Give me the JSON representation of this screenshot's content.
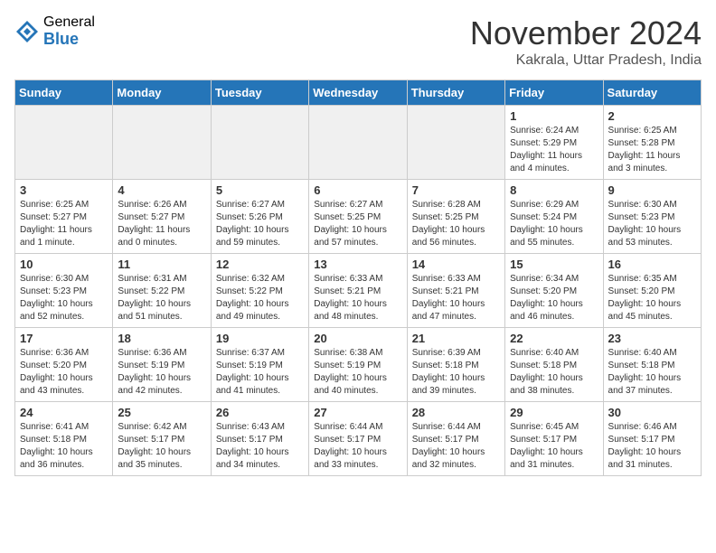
{
  "logo": {
    "general": "General",
    "blue": "Blue"
  },
  "header": {
    "month": "November 2024",
    "location": "Kakrala, Uttar Pradesh, India"
  },
  "weekdays": [
    "Sunday",
    "Monday",
    "Tuesday",
    "Wednesday",
    "Thursday",
    "Friday",
    "Saturday"
  ],
  "weeks": [
    [
      {
        "day": "",
        "sunrise": "",
        "sunset": "",
        "daylight": "",
        "empty": true
      },
      {
        "day": "",
        "sunrise": "",
        "sunset": "",
        "daylight": "",
        "empty": true
      },
      {
        "day": "",
        "sunrise": "",
        "sunset": "",
        "daylight": "",
        "empty": true
      },
      {
        "day": "",
        "sunrise": "",
        "sunset": "",
        "daylight": "",
        "empty": true
      },
      {
        "day": "",
        "sunrise": "",
        "sunset": "",
        "daylight": "",
        "empty": true
      },
      {
        "day": "1",
        "sunrise": "Sunrise: 6:24 AM",
        "sunset": "Sunset: 5:29 PM",
        "daylight": "Daylight: 11 hours and 4 minutes.",
        "empty": false
      },
      {
        "day": "2",
        "sunrise": "Sunrise: 6:25 AM",
        "sunset": "Sunset: 5:28 PM",
        "daylight": "Daylight: 11 hours and 3 minutes.",
        "empty": false
      }
    ],
    [
      {
        "day": "3",
        "sunrise": "Sunrise: 6:25 AM",
        "sunset": "Sunset: 5:27 PM",
        "daylight": "Daylight: 11 hours and 1 minute.",
        "empty": false
      },
      {
        "day": "4",
        "sunrise": "Sunrise: 6:26 AM",
        "sunset": "Sunset: 5:27 PM",
        "daylight": "Daylight: 11 hours and 0 minutes.",
        "empty": false
      },
      {
        "day": "5",
        "sunrise": "Sunrise: 6:27 AM",
        "sunset": "Sunset: 5:26 PM",
        "daylight": "Daylight: 10 hours and 59 minutes.",
        "empty": false
      },
      {
        "day": "6",
        "sunrise": "Sunrise: 6:27 AM",
        "sunset": "Sunset: 5:25 PM",
        "daylight": "Daylight: 10 hours and 57 minutes.",
        "empty": false
      },
      {
        "day": "7",
        "sunrise": "Sunrise: 6:28 AM",
        "sunset": "Sunset: 5:25 PM",
        "daylight": "Daylight: 10 hours and 56 minutes.",
        "empty": false
      },
      {
        "day": "8",
        "sunrise": "Sunrise: 6:29 AM",
        "sunset": "Sunset: 5:24 PM",
        "daylight": "Daylight: 10 hours and 55 minutes.",
        "empty": false
      },
      {
        "day": "9",
        "sunrise": "Sunrise: 6:30 AM",
        "sunset": "Sunset: 5:23 PM",
        "daylight": "Daylight: 10 hours and 53 minutes.",
        "empty": false
      }
    ],
    [
      {
        "day": "10",
        "sunrise": "Sunrise: 6:30 AM",
        "sunset": "Sunset: 5:23 PM",
        "daylight": "Daylight: 10 hours and 52 minutes.",
        "empty": false
      },
      {
        "day": "11",
        "sunrise": "Sunrise: 6:31 AM",
        "sunset": "Sunset: 5:22 PM",
        "daylight": "Daylight: 10 hours and 51 minutes.",
        "empty": false
      },
      {
        "day": "12",
        "sunrise": "Sunrise: 6:32 AM",
        "sunset": "Sunset: 5:22 PM",
        "daylight": "Daylight: 10 hours and 49 minutes.",
        "empty": false
      },
      {
        "day": "13",
        "sunrise": "Sunrise: 6:33 AM",
        "sunset": "Sunset: 5:21 PM",
        "daylight": "Daylight: 10 hours and 48 minutes.",
        "empty": false
      },
      {
        "day": "14",
        "sunrise": "Sunrise: 6:33 AM",
        "sunset": "Sunset: 5:21 PM",
        "daylight": "Daylight: 10 hours and 47 minutes.",
        "empty": false
      },
      {
        "day": "15",
        "sunrise": "Sunrise: 6:34 AM",
        "sunset": "Sunset: 5:20 PM",
        "daylight": "Daylight: 10 hours and 46 minutes.",
        "empty": false
      },
      {
        "day": "16",
        "sunrise": "Sunrise: 6:35 AM",
        "sunset": "Sunset: 5:20 PM",
        "daylight": "Daylight: 10 hours and 45 minutes.",
        "empty": false
      }
    ],
    [
      {
        "day": "17",
        "sunrise": "Sunrise: 6:36 AM",
        "sunset": "Sunset: 5:20 PM",
        "daylight": "Daylight: 10 hours and 43 minutes.",
        "empty": false
      },
      {
        "day": "18",
        "sunrise": "Sunrise: 6:36 AM",
        "sunset": "Sunset: 5:19 PM",
        "daylight": "Daylight: 10 hours and 42 minutes.",
        "empty": false
      },
      {
        "day": "19",
        "sunrise": "Sunrise: 6:37 AM",
        "sunset": "Sunset: 5:19 PM",
        "daylight": "Daylight: 10 hours and 41 minutes.",
        "empty": false
      },
      {
        "day": "20",
        "sunrise": "Sunrise: 6:38 AM",
        "sunset": "Sunset: 5:19 PM",
        "daylight": "Daylight: 10 hours and 40 minutes.",
        "empty": false
      },
      {
        "day": "21",
        "sunrise": "Sunrise: 6:39 AM",
        "sunset": "Sunset: 5:18 PM",
        "daylight": "Daylight: 10 hours and 39 minutes.",
        "empty": false
      },
      {
        "day": "22",
        "sunrise": "Sunrise: 6:40 AM",
        "sunset": "Sunset: 5:18 PM",
        "daylight": "Daylight: 10 hours and 38 minutes.",
        "empty": false
      },
      {
        "day": "23",
        "sunrise": "Sunrise: 6:40 AM",
        "sunset": "Sunset: 5:18 PM",
        "daylight": "Daylight: 10 hours and 37 minutes.",
        "empty": false
      }
    ],
    [
      {
        "day": "24",
        "sunrise": "Sunrise: 6:41 AM",
        "sunset": "Sunset: 5:18 PM",
        "daylight": "Daylight: 10 hours and 36 minutes.",
        "empty": false
      },
      {
        "day": "25",
        "sunrise": "Sunrise: 6:42 AM",
        "sunset": "Sunset: 5:17 PM",
        "daylight": "Daylight: 10 hours and 35 minutes.",
        "empty": false
      },
      {
        "day": "26",
        "sunrise": "Sunrise: 6:43 AM",
        "sunset": "Sunset: 5:17 PM",
        "daylight": "Daylight: 10 hours and 34 minutes.",
        "empty": false
      },
      {
        "day": "27",
        "sunrise": "Sunrise: 6:44 AM",
        "sunset": "Sunset: 5:17 PM",
        "daylight": "Daylight: 10 hours and 33 minutes.",
        "empty": false
      },
      {
        "day": "28",
        "sunrise": "Sunrise: 6:44 AM",
        "sunset": "Sunset: 5:17 PM",
        "daylight": "Daylight: 10 hours and 32 minutes.",
        "empty": false
      },
      {
        "day": "29",
        "sunrise": "Sunrise: 6:45 AM",
        "sunset": "Sunset: 5:17 PM",
        "daylight": "Daylight: 10 hours and 31 minutes.",
        "empty": false
      },
      {
        "day": "30",
        "sunrise": "Sunrise: 6:46 AM",
        "sunset": "Sunset: 5:17 PM",
        "daylight": "Daylight: 10 hours and 31 minutes.",
        "empty": false
      }
    ]
  ]
}
